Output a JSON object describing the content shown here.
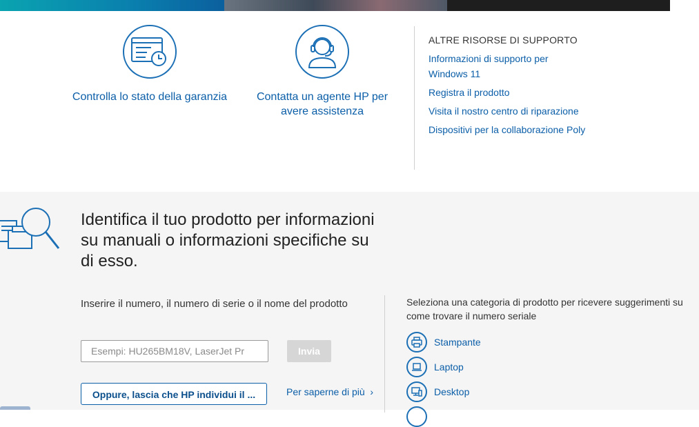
{
  "tiles": {
    "warranty_label": "Controlla lo stato della garanzia",
    "agent_label": "Contatta un agente HP per avere assistenza"
  },
  "resources": {
    "heading": "ALTRE RISORSE DI SUPPORTO",
    "links": [
      "Informazioni di supporto per Windows 11",
      "Registra il prodotto",
      "Visita il nostro centro di riparazione",
      "Dispositivi per la collaborazione Poly"
    ]
  },
  "identify": {
    "heading": "Identifica il tuo prodotto per informazioni su manuali o informazioni specifiche su di esso.",
    "prompt": "Inserire il numero, il numero di serie o il nome del prodotto",
    "input_placeholder": "Esempi: HU265BM18V, LaserJet Pr",
    "input_value": "",
    "submit_label": "Invia",
    "detect_label": "Oppure, lascia che HP individui il ...",
    "learn_more_label": "Per saperne di più",
    "category_prompt": "Seleziona una categoria di prodotto per ricevere suggerimenti su come trovare il numero seriale",
    "categories": [
      "Stampante",
      "Laptop",
      "Desktop"
    ]
  },
  "colors": {
    "link": "#0b5ea8",
    "icon_stroke": "#1b6fb5",
    "section_bg": "#f5f5f5",
    "disabled_button": "#d6d6d6"
  },
  "icons": {
    "warranty": "warranty-calendar-clock-icon",
    "agent": "support-agent-headset-icon",
    "identify": "product-search-magnifier-icon",
    "printer": "printer-icon",
    "laptop": "laptop-icon",
    "desktop": "desktop-icon",
    "chevron": "chevron-right-icon"
  }
}
